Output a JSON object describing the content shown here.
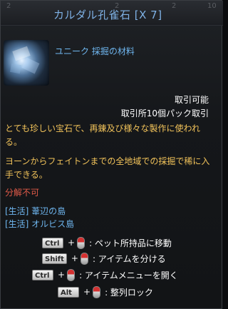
{
  "bg_numbers": [
    "2",
    "2",
    "2",
    "10"
  ],
  "item": {
    "title": "カルダル孔雀石 [X 7]",
    "icon": "gem-ore-icon",
    "category": "ユニーク 採掘の材料"
  },
  "trade": {
    "tradable": "取引可能",
    "pack": "取引所10個パック取引"
  },
  "description": [
    "とても珍しい宝石で、再錬及び様々な製作に使われる。",
    "ヨーンからフェイトンまでの全地域での採掘で稀に入手できる。"
  ],
  "dismantle": "分解不可",
  "life_locations": [
    "[生活] 葦辺の島",
    "[生活] オルビス島"
  ],
  "hints": [
    {
      "key": "Ctrl",
      "text": ": ペット所持品に移動"
    },
    {
      "key": "Shift",
      "text": ": アイテムを分ける"
    },
    {
      "key": "Ctrl",
      "text": ": アイテムメニューを開く"
    },
    {
      "key": "Alt",
      "text": ": 整列ロック"
    }
  ],
  "colors": {
    "title": "#7fb2e6",
    "category": "#6fb7f0",
    "description": "#f2c35a",
    "warning": "#e05a48"
  }
}
